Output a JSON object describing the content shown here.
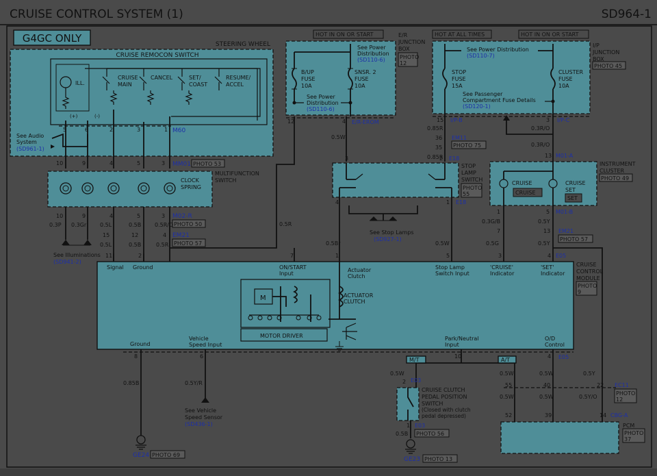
{
  "header": {
    "title": "CRUISE CONTROL SYSTEM (1)",
    "code": "SD964-1"
  },
  "engine_badge": "G4GC ONLY",
  "power_labels": {
    "hot_on_start_1": "HOT IN ON OR START",
    "hot_all_times": "HOT AT ALL TIMES",
    "hot_on_start_2": "HOT IN ON OR START"
  },
  "steering": {
    "title": "STEERING WHEEL",
    "switch_title": "CRUISE REMOCON SWITCH",
    "ill": "ILL.",
    "plus": "(+)",
    "minus": "(-)",
    "switches": [
      "CRUISE",
      "MAIN",
      "CANCEL",
      "SET/",
      "COAST",
      "RESUME/",
      "ACCEL"
    ],
    "connector": "M60",
    "audio_1": "See Audio",
    "audio_2": "System",
    "audio_ref": "(SD961-1)"
  },
  "pins_m60": [
    "5",
    "6",
    "2",
    "3",
    "1"
  ],
  "pins_mm01": [
    "10",
    "9",
    "4",
    "5",
    "3"
  ],
  "mm01": "MM01",
  "mm01_photo": "PHOTO 53",
  "clock_spring": {
    "label_1": "CLOCK",
    "label_2": "SPRING",
    "mf_1": "MULTIFUNCTION",
    "mf_2": "SWITCH"
  },
  "pins_m02": [
    "10",
    "9",
    "4",
    "5",
    "3"
  ],
  "m02": "M02-R",
  "m02_photo": "PHOTO 50",
  "wires_left": [
    "0.3P",
    "0.3Gr",
    "0.5L",
    "0.5B",
    "0.5R/O"
  ],
  "pins_em21": [
    "15",
    "12",
    "4"
  ],
  "em21": "EM21",
  "em21_photo": "PHOTO 57",
  "wires_left_2": [
    "0.5L",
    "0.5B",
    "0.5R"
  ],
  "illum_1": "See Illuminations",
  "illum_ref": "(SD941-2)",
  "er_box": {
    "title_1": "E/R",
    "title_2": "JUNCTION",
    "title_3": "BOX",
    "photo_1": "PHOTO",
    "photo_2": "12",
    "see_pd_1": "See Power",
    "see_pd_2": "Distribution",
    "see_pd_ref": "(SD110-6)",
    "fuse1": [
      "B/UP",
      "FUSE",
      "10A"
    ],
    "fuse2": [
      "SNSR. 2",
      "FUSE",
      "10A"
    ],
    "pd_1": "See Power",
    "pd_2": "Distribution",
    "pd_ref": "(SD110-6)",
    "pin_12": "12",
    "pin_4": "4",
    "conn": "E/R-EROM"
  },
  "ip_box": {
    "title_1": "I/P",
    "title_2": "JUNCTION",
    "title_3": "BOX",
    "photo": "PHOTO 45",
    "see_pd": "See Power Distribution",
    "see_pd_ref": "(SD110-7)",
    "fuse1": [
      "STOP",
      "FUSE",
      "15A"
    ],
    "fuse2": [
      "CLUSTER",
      "FUSE",
      "10A"
    ],
    "pass_1": "See Passenger",
    "pass_2": "Compartment Fuse Details",
    "pass_ref": "(SD120-1)",
    "pin_15": "15",
    "conn_b": "I/P-B",
    "pin_3": "3",
    "conn_c": "I/P-C"
  },
  "stop_lamp": {
    "w1": "0.85R",
    "pin36": "36",
    "em11": "EM11",
    "em11_photo": "PHOTO 75",
    "pin35": "35",
    "w2": "0.85R",
    "pin3": "3",
    "pin2": "2",
    "e18": "E18",
    "label": [
      "STOP",
      "LAMP",
      "SWITCH"
    ],
    "photo": [
      "PHOTO",
      "55"
    ],
    "pin4": "4",
    "pin1": "1",
    "see_1": "See Stop Lamps",
    "see_ref": "(SD927-1)"
  },
  "w_05w": "0.5W",
  "w_05r": "0.5R",
  "w_05br": "0.5Br",
  "w_05w2": "0.5W",
  "cluster": {
    "w1": "0.3R/O",
    "w2": "0.3R/O",
    "pin13": "13",
    "conn": "M01-A",
    "title_1": "INSTRUMENT",
    "title_2": "CLUSTER",
    "photo": "PHOTO 49",
    "cruise": "CRUISE",
    "cruise_box": "CRUISE",
    "cruise_set_1": "CRUISE",
    "cruise_set_2": "SET",
    "set_box": "SET",
    "pin1": "1",
    "pin5": "5",
    "conn_b": "M01-B",
    "w3": "0.3G/B",
    "w4": "0.5Y",
    "pin7": "7",
    "pin13b": "13",
    "em21": "EM21",
    "em21_photo": "PHOTO 57",
    "w5": "0.5G",
    "w6": "0.5Y"
  },
  "module": {
    "pins_top": [
      "11",
      "2",
      "7",
      "1",
      "5",
      "3",
      "4"
    ],
    "e05": "E05",
    "title": [
      "CRUISE",
      "CONTROL",
      "MODULE"
    ],
    "photo": [
      "PHOTO",
      "9"
    ],
    "labels_top": {
      "signal": "Signal",
      "ground": "Ground",
      "onstart_1": "ON/START",
      "onstart_2": "Input",
      "act_1": "Actuator",
      "act_2": "Clutch",
      "stop_1": "Stop Lamp",
      "stop_2": "Switch Input",
      "cruise_1": "'CRUISE'",
      "cruise_2": "Indicator",
      "set_1": "'SET'",
      "set_2": "Indicator"
    },
    "motor": "M",
    "act_clutch_1": "ACTUATOR",
    "act_clutch_2": "CLUTCH",
    "motor_driver": "MOTOR DRIVER",
    "labels_bot": {
      "ground": "Ground",
      "vss_1": "Vehicle",
      "vss_2": "Speed Input",
      "pn_1": "Park/Neutral",
      "pn_2": "Input",
      "od_1": "O/D",
      "od_2": "Control"
    },
    "pins_bot": [
      "8",
      "6",
      "10",
      "4"
    ],
    "e05b": "E05"
  },
  "bottom": {
    "w_085b": "0.85B",
    "w_05yr": "0.5Y/R",
    "vss_1": "See Vehicle",
    "vss_2": "Speed Sensor",
    "vss_ref": "(SD436-1)",
    "ge24": "GE24",
    "ge24_photo": "PHOTO 69",
    "mt": "M/T",
    "at": "A/T",
    "w_05w_a": "0.5W",
    "pin2": "2",
    "e03": "E03",
    "clutch": [
      "CRUISE CLUTCH",
      "PEDAL POSITION",
      "SWITCH",
      "(Closed with clutch",
      "pedal depressed)"
    ],
    "pin1": "1",
    "e03b": "E03",
    "w_05b": "0.5B",
    "e03_photo": "PHOTO 56",
    "ge23": "GE23",
    "ge23_photo": "PHOTO 13",
    "w_05w_b": "0.5W",
    "w_05w_c": "0.5W",
    "w_05w_d": "0.5W",
    "w_05y": "0.5Y",
    "w_05y2": "0.5Y",
    "w_05yo": "0.5Y/O",
    "pins_ec11": [
      "55",
      "40",
      "22"
    ],
    "ec11": "EC11",
    "ec11_photo": [
      "PHOTO",
      "12"
    ],
    "pins_cbg": [
      "52",
      "39",
      "14"
    ],
    "cbga": "CBG-A",
    "pcm": "PCM",
    "pcm_photo": [
      "PHOTO",
      "37"
    ]
  }
}
